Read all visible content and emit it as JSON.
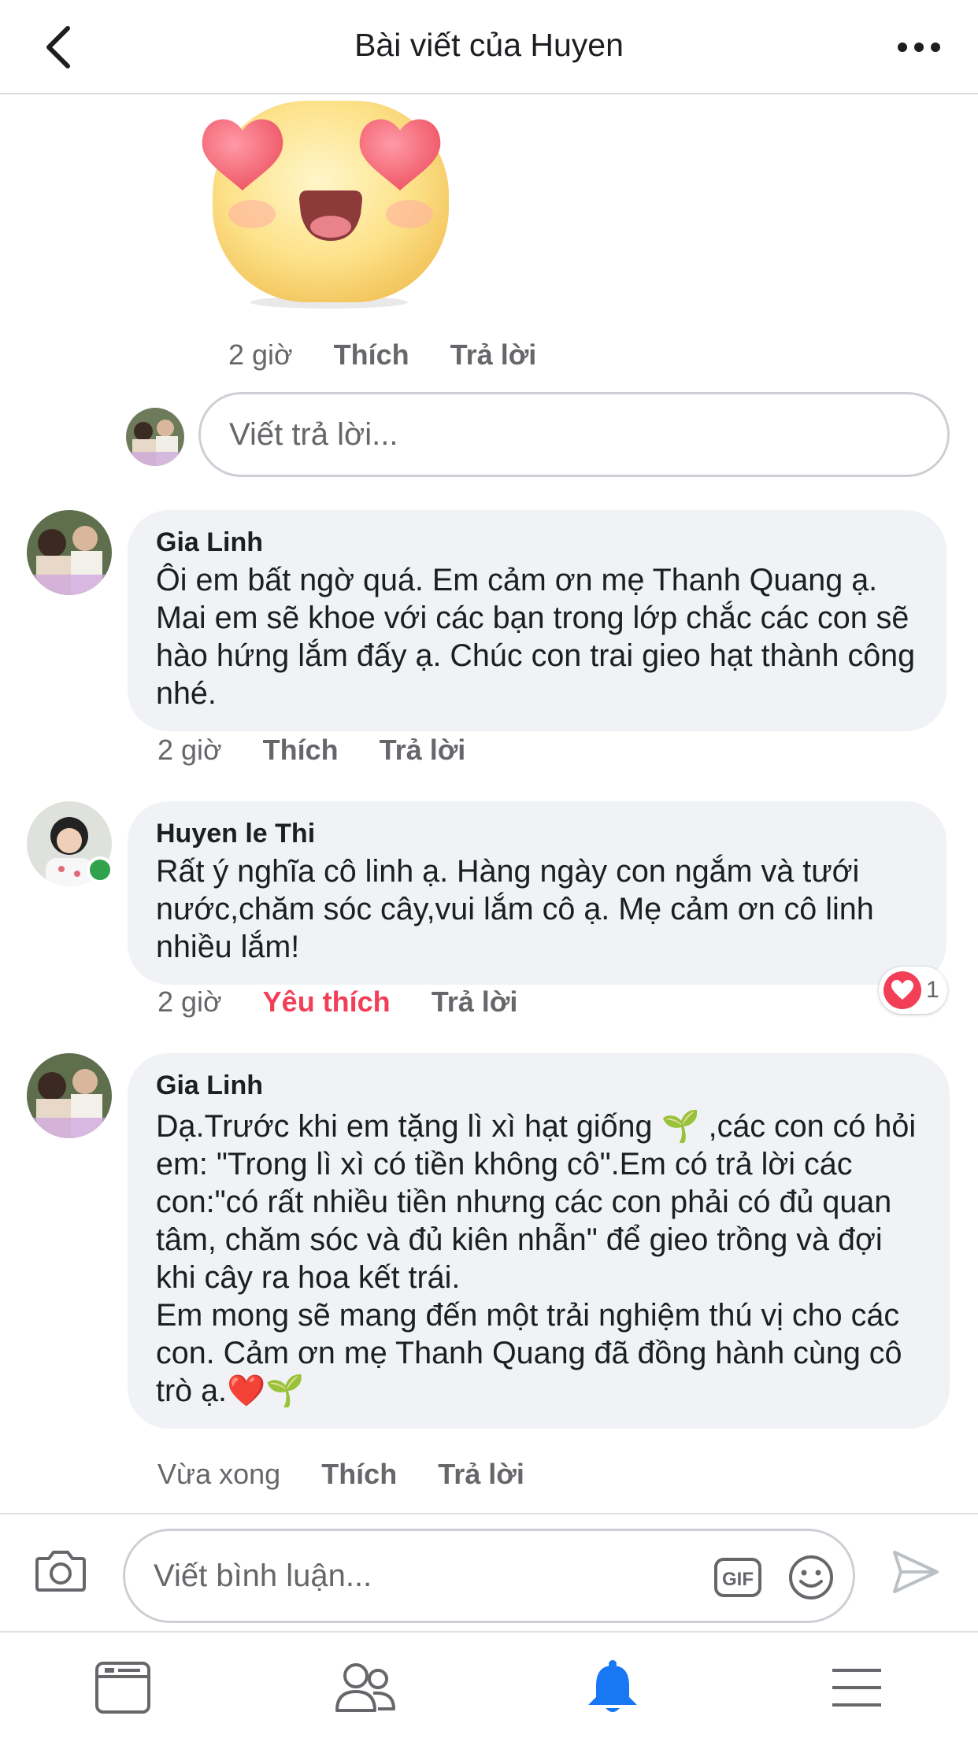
{
  "header": {
    "title": "Bài viết của Huyen"
  },
  "top_reply": {
    "time": "2 giờ",
    "like_label": "Thích",
    "reply_label": "Trả lời"
  },
  "reply_box": {
    "placeholder": "Viết trả lời..."
  },
  "comments": [
    {
      "author": "Gia Linh",
      "text": "Ôi em bất ngờ quá. Em cảm ơn mẹ Thanh Quang ạ. Mai em sẽ khoe với các bạn trong lớp chắc các con sẽ hào hứng lắm đấy ạ. Chúc con trai gieo hạt thành công nhé.",
      "time": "2 giờ",
      "like_label": "Thích",
      "reply_label": "Trả lời"
    },
    {
      "author": "Huyen le Thi",
      "text": "Rất ý nghĩa cô linh ạ. Hàng ngày con ngắm và tưới nước,chăm sóc cây,vui lắm cô ạ. Mẹ cảm ơn cô linh nhiều lắm!",
      "time": "2 giờ",
      "like_label": "Yêu thích",
      "reply_label": "Trả lời",
      "reaction_count": "1"
    },
    {
      "author": "Gia Linh",
      "text": "Dạ.Trước khi em tặng lì xì hạt giống 🌱 ,các con có hỏi em: \"Trong lì xì có tiền không cô\".Em có trả lời các con:\"có rất nhiều tiền nhưng các con phải có đủ quan tâm, chăm sóc và đủ kiên nhẫn\" để gieo trồng và đợi khi cây ra hoa kết trái.\nEm mong sẽ mang đến một trải nghiệm thú vị cho các con. Cảm ơn mẹ Thanh Quang đã đồng hành cùng cô trò ạ.❤️🌱",
      "time": "Vừa xong",
      "like_label": "Thích",
      "reply_label": "Trả lời"
    }
  ],
  "composer": {
    "placeholder": "Viết bình luận..."
  },
  "colors": {
    "accent": "#1877f2",
    "love": "#f33e58",
    "online": "#31a24c",
    "bubble": "#f0f2f5",
    "meta": "#65676b"
  },
  "icons": [
    "back-icon",
    "more-icon",
    "camera-icon",
    "gif-icon",
    "smiley-icon",
    "send-icon",
    "news-feed-icon",
    "friends-icon",
    "notifications-icon",
    "menu-icon"
  ]
}
